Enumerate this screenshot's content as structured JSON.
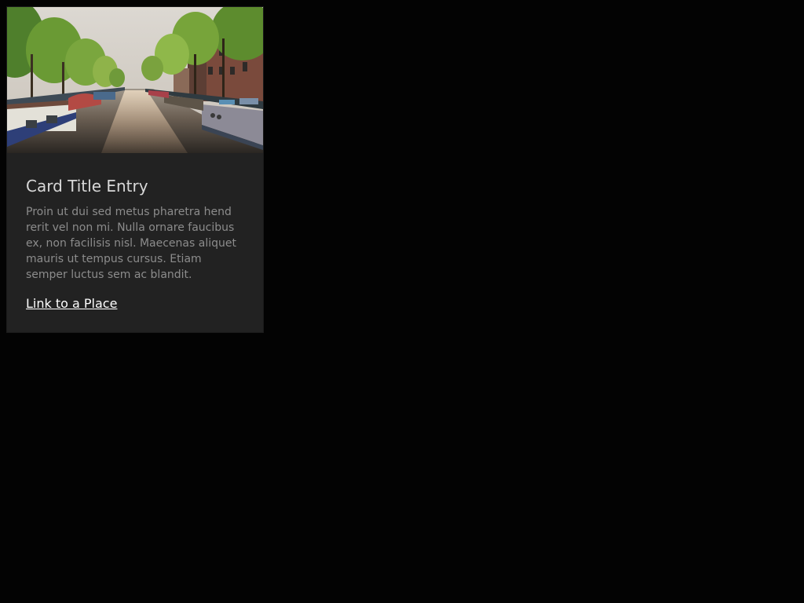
{
  "card": {
    "image": {
      "icon": "canal-photo"
    },
    "title": "Card Title Entry",
    "text": "Proin ut dui sed metus pharetra hend rerit vel non mi. Nulla ornare faucibus ex, non facilisis nisl. Maecenas aliquet mauris ut tempus cursus. Etiam semper luctus sem ac blandit.",
    "link_label": "Link to a Place"
  },
  "colors": {
    "page_background": "#030303",
    "card_background": "#222222",
    "title": "#d8d8d8",
    "body_text": "#8c8c8c",
    "link": "#ffffff"
  }
}
